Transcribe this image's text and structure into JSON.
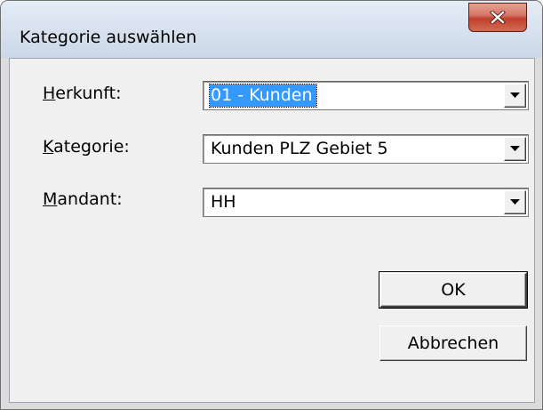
{
  "window": {
    "title": "Kategorie auswählen",
    "close_glyph": "X"
  },
  "form": {
    "herkunft": {
      "label_underlined": "H",
      "label_rest": "erkunft:",
      "value": "01 - Kunden"
    },
    "kategorie": {
      "label_underlined": "K",
      "label_rest": "ategorie:",
      "value": "Kunden PLZ Gebiet 5"
    },
    "mandant": {
      "label_underlined": "M",
      "label_rest": "andant:",
      "value": "HH"
    }
  },
  "buttons": {
    "ok": "OK",
    "cancel": "Abbrechen"
  },
  "icons": {
    "close": "close-icon",
    "dropdown": "chevron-down-icon"
  },
  "colors": {
    "selection": "#3399ff",
    "close_button": "#c2402c",
    "dialog_face": "#f0f0f0"
  }
}
